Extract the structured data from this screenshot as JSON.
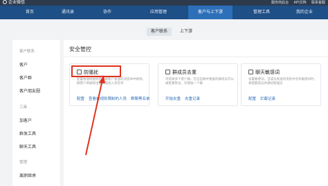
{
  "topbar": {
    "logo": "企业微信",
    "links": [
      "服务商后台",
      "API文档",
      "联系客服"
    ]
  },
  "nav": {
    "items": [
      "首页",
      "通讯录",
      "协作",
      "应用管理",
      "客户与上下游",
      "管理工具",
      "我的企业"
    ],
    "active": "客户与上下游"
  },
  "subtabs": {
    "items": [
      "客户联系",
      "上下游"
    ],
    "active": "客户联系"
  },
  "sidebar": {
    "group1": "客户联系",
    "items1": [
      "客户",
      "客户群",
      "客户朋友圈"
    ],
    "group2": "工具",
    "items2": [
      "加客户",
      "群发工具",
      "聊天工具"
    ],
    "group3": "管理",
    "items3": [
      "离职继承"
    ]
  },
  "content": {
    "title": "安全管控",
    "cards": [
      {
        "icon": "anti-harassment-icon",
        "title": "防骚扰",
        "desc": "配置防骚扰规则后，群客户发送的消息命中规则，群客户将被移出群聊或加入黑名单",
        "links": [
          "配置",
          "查看被规则限制的人员",
          "群聊黑名单"
        ]
      },
      {
        "icon": "duplicate-member-icon",
        "title": "群成员去重",
        "desc": "可选择多个客户群，在这些群中重复的群成员可以被批量移出，仅保留一个群",
        "links": [
          "开始去重",
          "去重记录"
        ]
      },
      {
        "icon": "chat-sensitive-icon",
        "title": "聊天敏感词",
        "desc": "设置敏感词，当成员发送的消息中含有敏感词时，将提醒成员并通知管理员",
        "links": [
          "配置",
          "拦截记录"
        ]
      }
    ]
  },
  "colors": {
    "nav_bg": "#1e4f87",
    "nav_active": "#2d6fb8",
    "link": "#2d6fb8",
    "highlight": "#e0311f"
  }
}
